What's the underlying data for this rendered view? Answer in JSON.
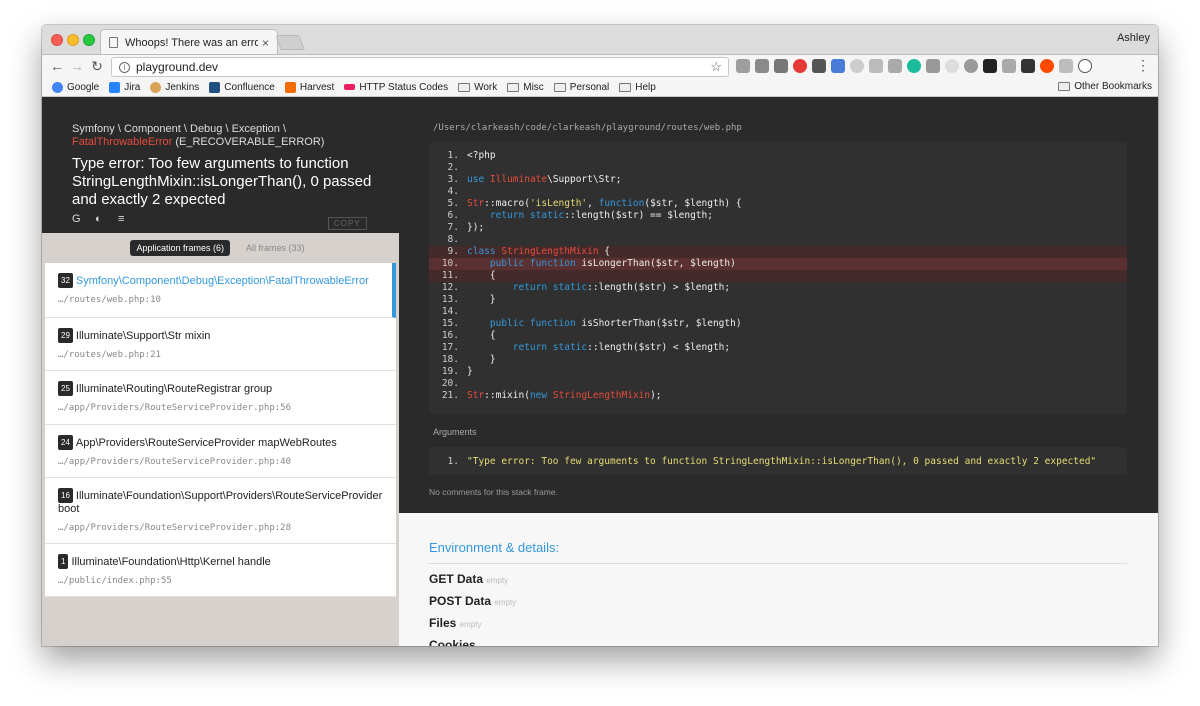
{
  "browser": {
    "tab_title": "Whoops! There was an error.",
    "tab_close": "×",
    "user_name": "Ashley",
    "url": "playground.dev",
    "back": "←",
    "forward": "→",
    "reload": "↻",
    "star": "☆",
    "menu": "⋮",
    "bookmarks": [
      {
        "label": "Google",
        "color": "#4285f4"
      },
      {
        "label": "Jira",
        "color": "#2684ff"
      },
      {
        "label": "Jenkins",
        "color": "#d9a35a"
      },
      {
        "label": "Confluence",
        "color": "#205081"
      },
      {
        "label": "Harvest",
        "color": "#f36c00"
      },
      {
        "label": "HTTP Status Codes",
        "color": "#e91e63"
      }
    ],
    "bookmark_folders": [
      "Work",
      "Misc",
      "Personal",
      "Help"
    ],
    "other_bookmarks": "Other Bookmarks"
  },
  "exception": {
    "class_prefix": "Symfony \\ Component \\ Debug \\ Exception \\",
    "class_name": "FatalThrowableError",
    "class_suffix": " (E_RECOVERABLE_ERROR)",
    "message": "Type error: Too few arguments to function StringLengthMixin::isLongerThan(), 0 passed and exactly 2 expected",
    "copy_label": "COPY"
  },
  "filters": {
    "application": "Application frames (6)",
    "all": "All frames (33)"
  },
  "frames": [
    {
      "index": "32",
      "class": "Symfony\\Component\\Debug\\Exception\\FatalThrowableError",
      "file": "…/routes/web.php:10"
    },
    {
      "index": "29",
      "class": "Illuminate\\Support\\Str mixin",
      "file": "…/routes/web.php:21"
    },
    {
      "index": "25",
      "class": "Illuminate\\Routing\\RouteRegistrar group",
      "file": "…/app/Providers/RouteServiceProvider.php:56"
    },
    {
      "index": "24",
      "class": "App\\Providers\\RouteServiceProvider mapWebRoutes",
      "file": "…/app/Providers/RouteServiceProvider.php:40"
    },
    {
      "index": "16",
      "class": "Illuminate\\Foundation\\Support\\Providers\\RouteServiceProvider boot",
      "file": "…/app/Providers/RouteServiceProvider.php:28"
    },
    {
      "index": "1",
      "class": "Illuminate\\Foundation\\Http\\Kernel handle",
      "file": "…/public/index.php:55"
    }
  ],
  "code": {
    "file_path": "/Users/clarkeash/code/clarkeash/playground/routes/web.php",
    "lines": [
      {
        "n": "1.",
        "html": "&lt;?php"
      },
      {
        "n": "2.",
        "html": ""
      },
      {
        "n": "3.",
        "html": "<span class=\"k\">use</span> <span class=\"c\">Illuminate</span>\\Support\\Str;"
      },
      {
        "n": "4.",
        "html": ""
      },
      {
        "n": "5.",
        "html": "<span class=\"c\">Str</span>::macro(<span class=\"s\">'isLength'</span>, <span class=\"k\">function</span>($str, $length) {"
      },
      {
        "n": "6.",
        "html": "    <span class=\"k\">return static</span>::length($str) == $length;"
      },
      {
        "n": "7.",
        "html": "});"
      },
      {
        "n": "8.",
        "html": ""
      },
      {
        "n": "9.",
        "html": "<span class=\"k\">class</span> <span class=\"c\">StringLengthMixin</span> {",
        "hl": "hl2"
      },
      {
        "n": "10.",
        "html": "    <span class=\"k\">public function</span> isLongerThan($str, $length)",
        "hl": "hl"
      },
      {
        "n": "11.",
        "html": "    {",
        "hl": "hl2"
      },
      {
        "n": "12.",
        "html": "        <span class=\"k\">return static</span>::length($str) &gt; $length;"
      },
      {
        "n": "13.",
        "html": "    }"
      },
      {
        "n": "14.",
        "html": ""
      },
      {
        "n": "15.",
        "html": "    <span class=\"k\">public function</span> isShorterThan($str, $length)"
      },
      {
        "n": "16.",
        "html": "    {"
      },
      {
        "n": "17.",
        "html": "        <span class=\"k\">return static</span>::length($str) &lt; $length;"
      },
      {
        "n": "18.",
        "html": "    }"
      },
      {
        "n": "19.",
        "html": "}"
      },
      {
        "n": "20.",
        "html": ""
      },
      {
        "n": "21.",
        "html": "<span class=\"c\">Str</span>::mixin(<span class=\"k\">new</span> <span class=\"c\">StringLengthMixin</span>);"
      }
    ],
    "arguments_label": "Arguments",
    "argument_number": "1.",
    "argument": "\"Type error: Too few arguments to function StringLengthMixin::isLongerThan(), 0 passed and exactly 2 expected\"",
    "no_comments": "No comments for this stack frame."
  },
  "environment": {
    "title": "Environment & details:",
    "empty": "empty",
    "items": [
      "GET Data",
      "POST Data",
      "Files",
      "Cookies"
    ]
  }
}
